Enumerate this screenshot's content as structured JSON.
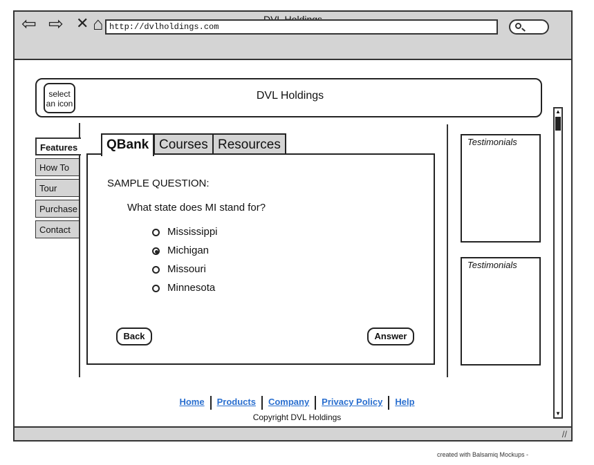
{
  "window": {
    "title": "DVL Holdings",
    "url": "http://dvlholdings.com"
  },
  "header": {
    "icon_placeholder_line1": "select",
    "icon_placeholder_line2": "an icon",
    "title": "DVL Holdings"
  },
  "sidebar": {
    "items": [
      {
        "label": "Features",
        "active": true
      },
      {
        "label": "How To",
        "active": false
      },
      {
        "label": "Tour",
        "active": false
      },
      {
        "label": "Purchase",
        "active": false
      },
      {
        "label": "Contact",
        "active": false
      }
    ]
  },
  "tabs": [
    {
      "label": "QBank",
      "active": true
    },
    {
      "label": "Courses",
      "active": false
    },
    {
      "label": "Resources",
      "active": false
    }
  ],
  "question": {
    "heading": "SAMPLE QUESTION:",
    "text": "What state does MI stand for?",
    "options": [
      {
        "label": "Mississippi",
        "selected": false
      },
      {
        "label": "Michigan",
        "selected": true
      },
      {
        "label": "Missouri",
        "selected": false
      },
      {
        "label": "Minnesota",
        "selected": false
      }
    ],
    "back_label": "Back",
    "answer_label": "Answer"
  },
  "testimonials": [
    {
      "title": "Testimonials"
    },
    {
      "title": "Testimonials"
    }
  ],
  "footer": {
    "links": [
      "Home",
      "Products",
      "Company",
      "Privacy Policy",
      "Help"
    ],
    "copyright": "Copyright DVL Holdings"
  },
  "credit": "created with Balsamiq Mockups -"
}
